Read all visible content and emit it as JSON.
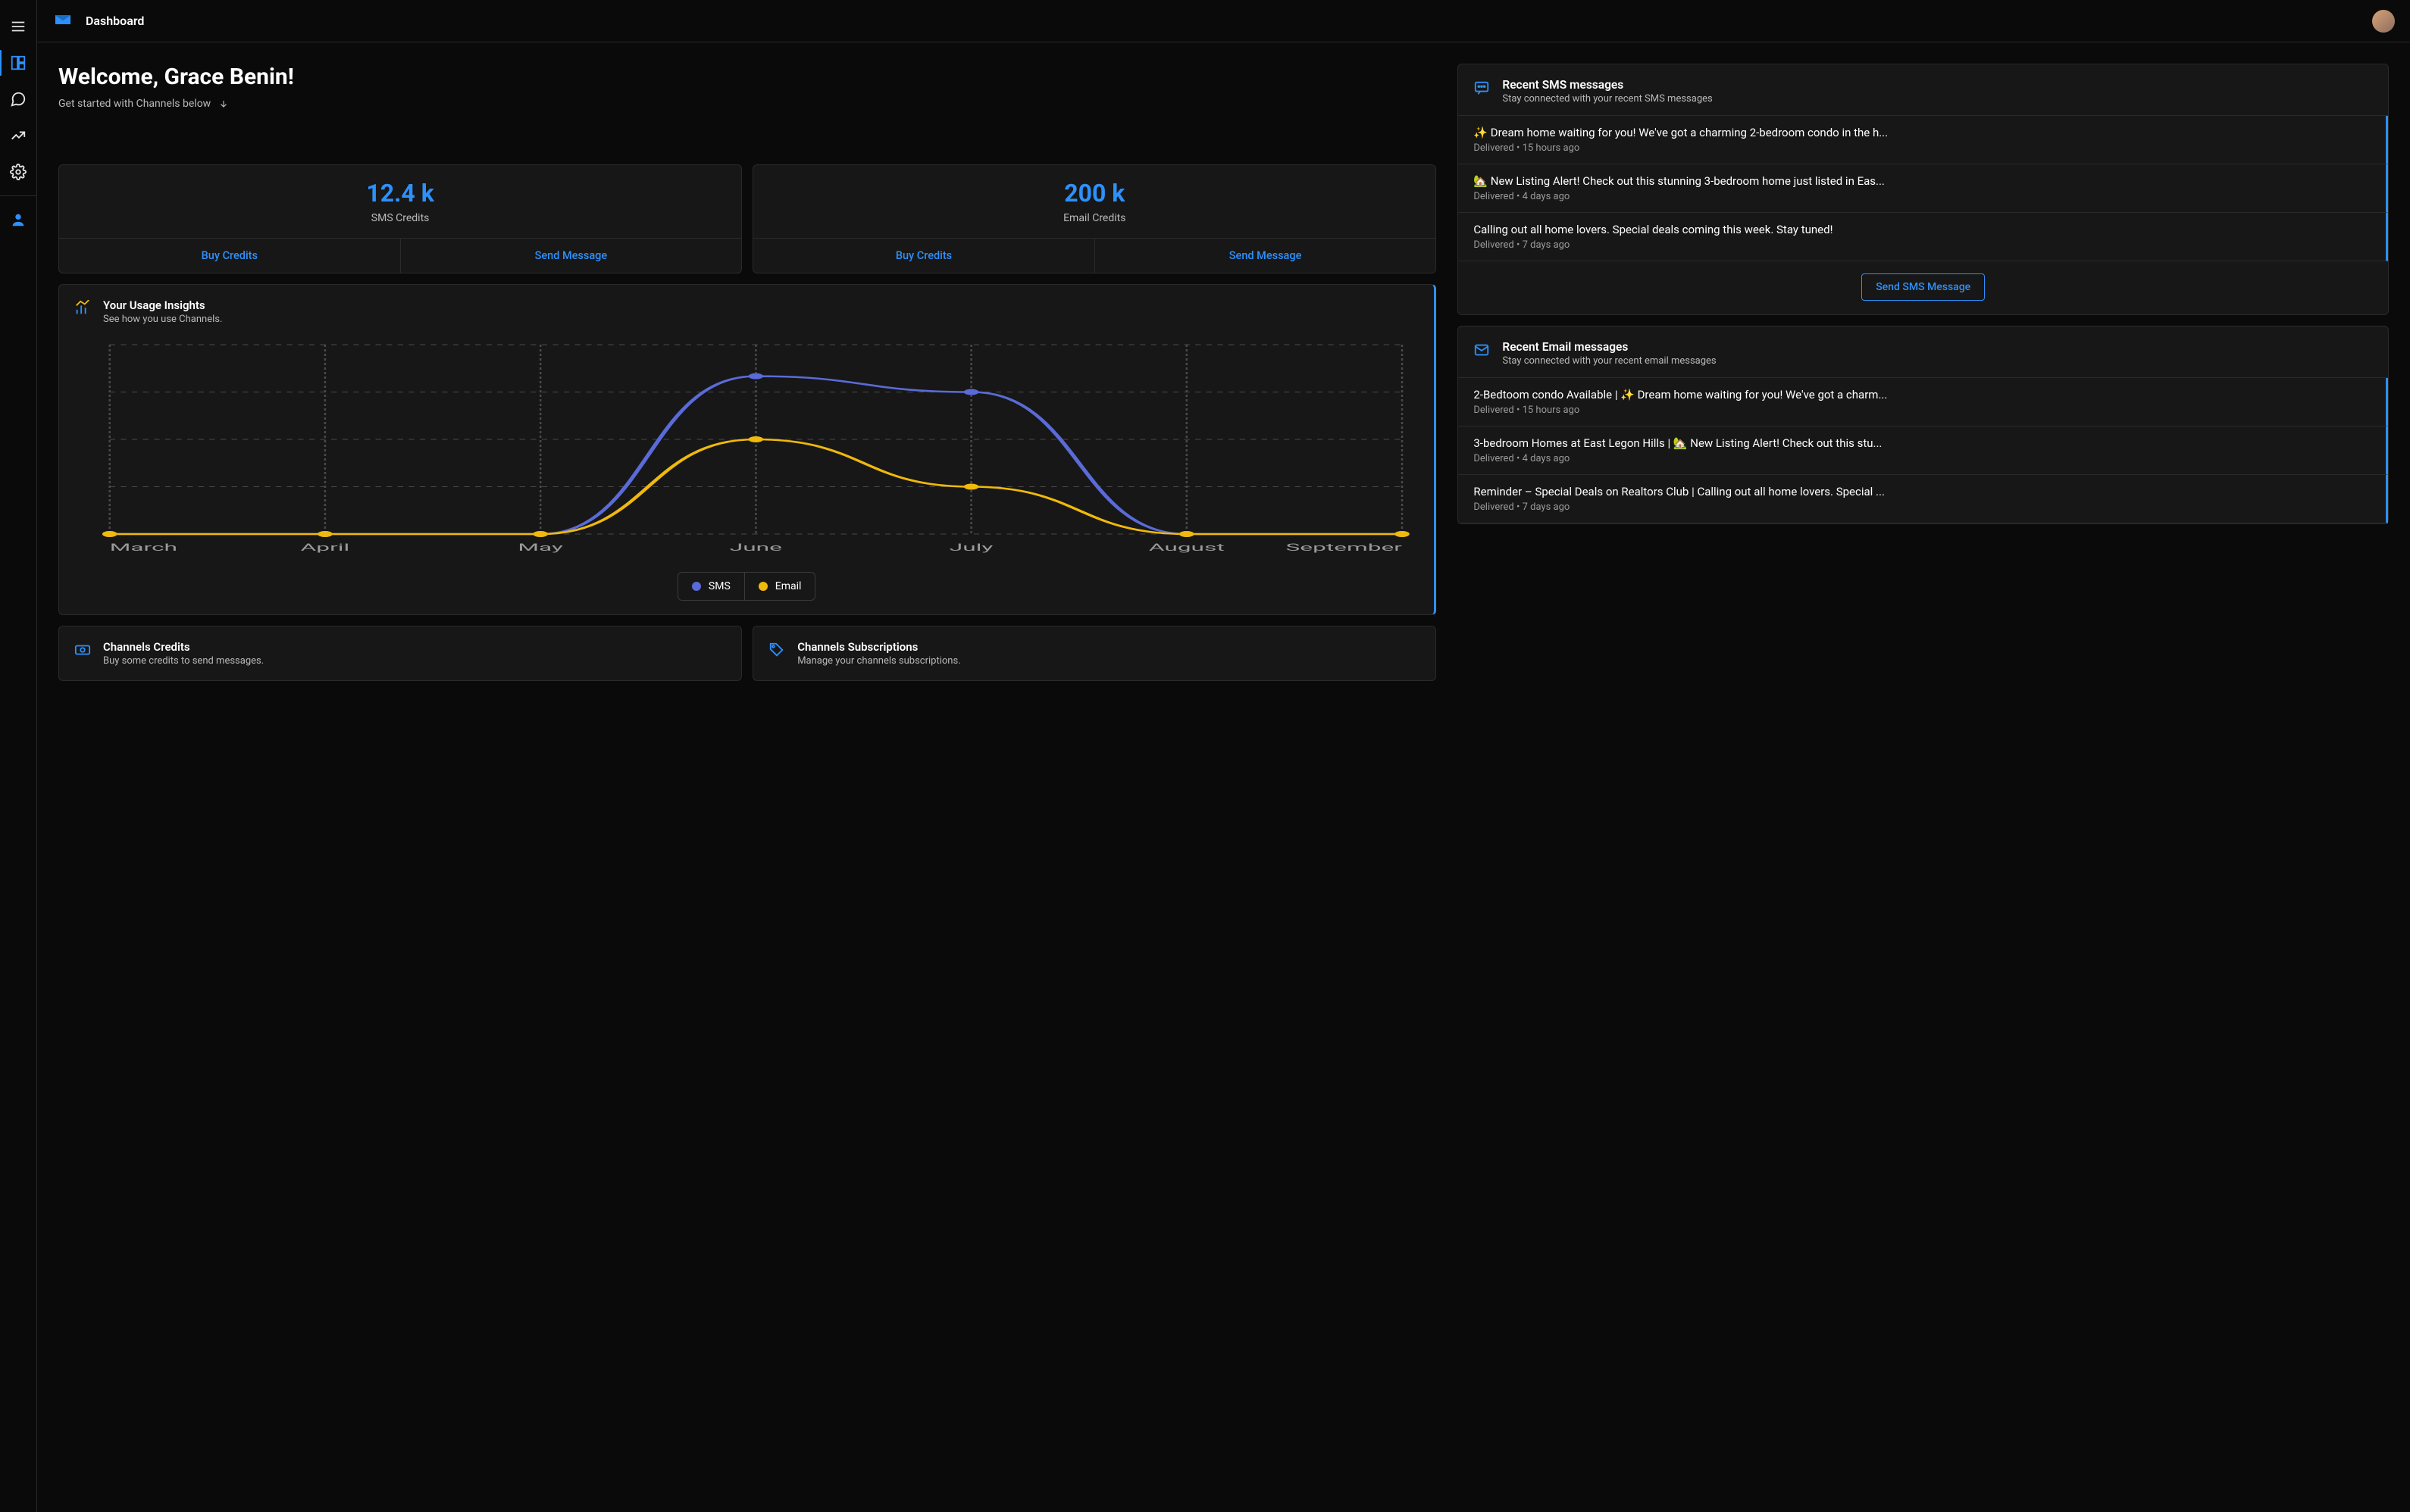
{
  "header": {
    "title": "Dashboard"
  },
  "welcome": {
    "heading": "Welcome, Grace Benin!",
    "subtitle": "Get started with Channels below"
  },
  "stats": {
    "sms": {
      "value": "12.4 k",
      "label": "SMS Credits",
      "buy": "Buy Credits",
      "send": "Send Message"
    },
    "email": {
      "value": "200 k",
      "label": "Email Credits",
      "buy": "Buy Credits",
      "send": "Send Message"
    }
  },
  "insights": {
    "title": "Your Usage Insights",
    "subtitle": "See how you use Channels.",
    "legend_sms": "SMS",
    "legend_email": "Email"
  },
  "chart_data": {
    "type": "line",
    "categories": [
      "March",
      "April",
      "May",
      "June",
      "July",
      "August",
      "September"
    ],
    "series": [
      {
        "name": "SMS",
        "values": [
          0,
          0,
          0,
          100,
          90,
          0,
          0
        ]
      },
      {
        "name": "Email",
        "values": [
          0,
          0,
          0,
          60,
          30,
          0,
          0
        ]
      }
    ],
    "xlabel": "",
    "ylabel": "",
    "ylim": [
      0,
      120
    ]
  },
  "bottom": {
    "credits": {
      "title": "Channels Credits",
      "subtitle": "Buy some credits to send messages."
    },
    "subs": {
      "title": "Channels Subscriptions",
      "subtitle": "Manage your channels subscriptions."
    }
  },
  "recent_sms": {
    "title": "Recent SMS messages",
    "subtitle": "Stay connected with your recent SMS messages",
    "send_btn": "Send SMS Message",
    "items": [
      {
        "title": "✨ Dream home waiting for you! We've got a charming 2-bedroom condo in the h...",
        "meta": "Delivered • 15 hours ago"
      },
      {
        "title": "🏡 New Listing Alert! Check out this stunning 3-bedroom home just listed in Eas...",
        "meta": "Delivered • 4 days ago"
      },
      {
        "title": "Calling out all home lovers. Special deals coming this week. Stay tuned!",
        "meta": "Delivered • 7 days ago"
      }
    ]
  },
  "recent_email": {
    "title": "Recent Email messages",
    "subtitle": "Stay connected with your recent email messages",
    "items": [
      {
        "title": "2-Bedtoom condo Available | ✨ Dream home waiting for you! We've got a charm...",
        "meta": "Delivered • 15 hours ago"
      },
      {
        "title": "3-bedroom Homes at East Legon Hills | 🏡 New Listing Alert! Check out this stu...",
        "meta": "Delivered • 4 days ago"
      },
      {
        "title": "Reminder – Special Deals on Realtors Club | Calling out all home lovers. Special ...",
        "meta": "Delivered • 7 days ago"
      }
    ]
  },
  "colors": {
    "accent": "#2e90fa",
    "sms": "#5a6bd8",
    "email": "#f0b90b"
  }
}
